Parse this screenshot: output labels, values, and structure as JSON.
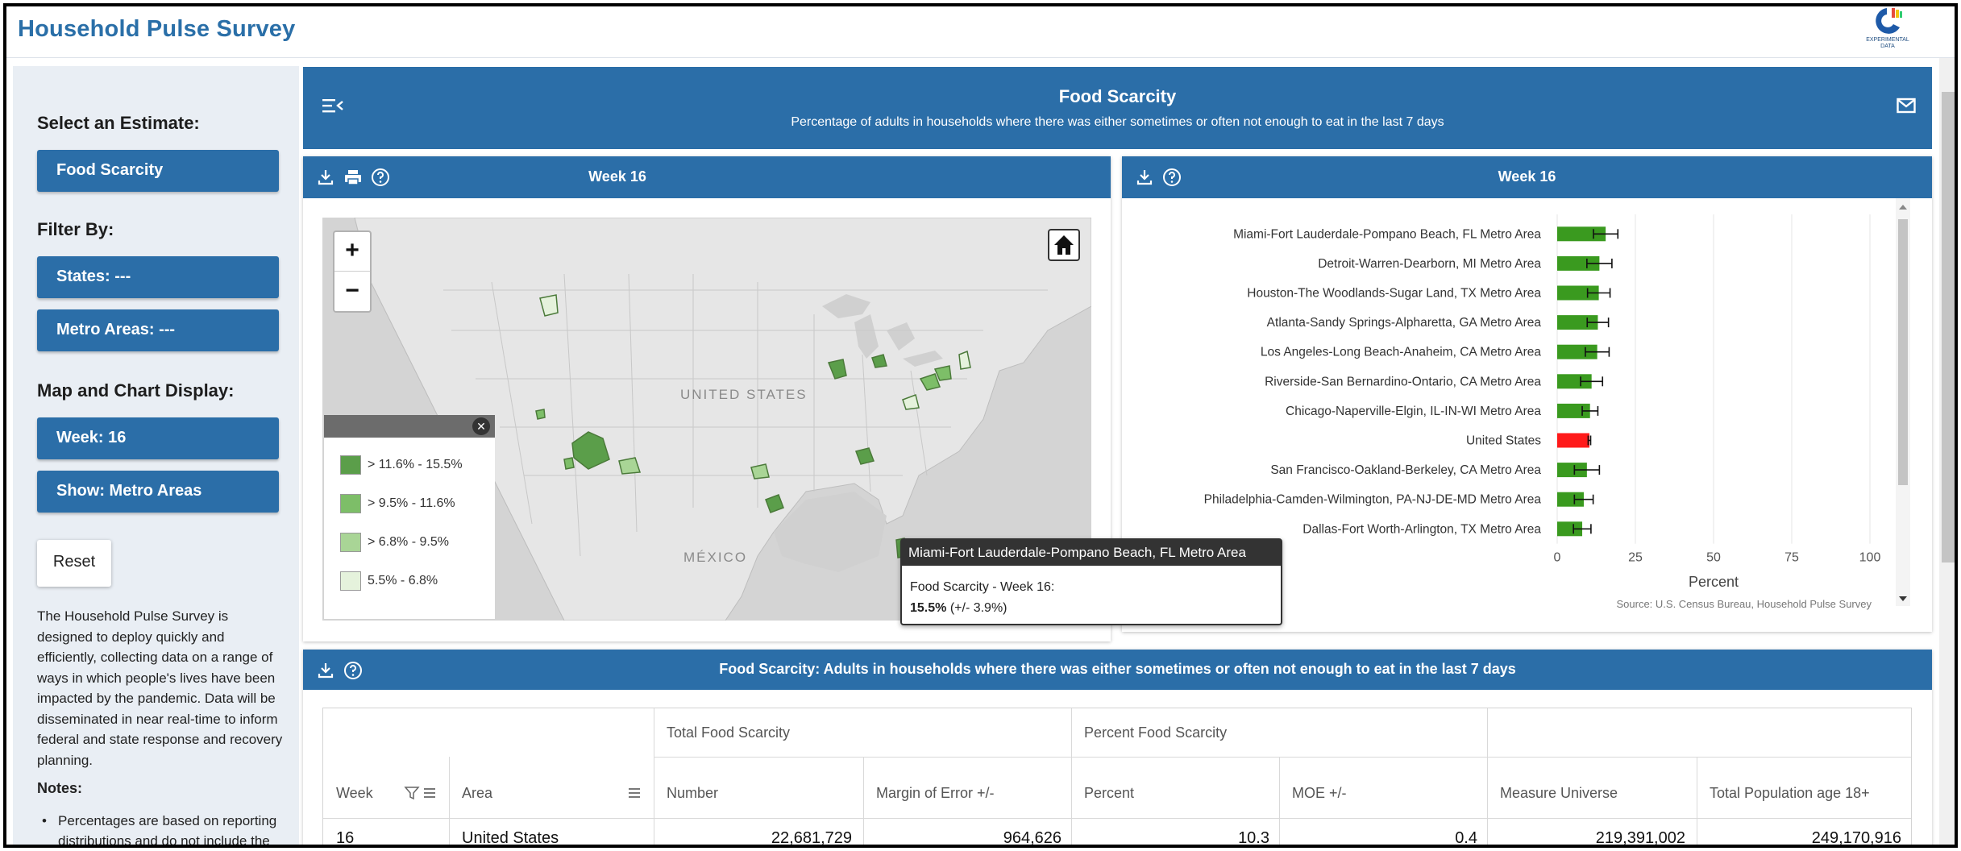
{
  "app": {
    "title": "Household Pulse Survey",
    "logo_text": "EXPERIMENTAL DATA"
  },
  "sidebar": {
    "select_heading": "Select an Estimate:",
    "estimate_button": "Food Scarcity",
    "filter_heading": "Filter By:",
    "states_button": "States: ---",
    "metros_button": "Metro Areas: ---",
    "display_heading": "Map and Chart Display:",
    "week_button": "Week: 16",
    "show_button": "Show: Metro Areas",
    "reset_button": "Reset",
    "about_text": "The Household Pulse Survey is designed to deploy quickly and efficiently, collecting data on a range of ways in which people's lives have been impacted by the pandemic. Data will be disseminated in near real-time to inform federal and state response and recovery planning.",
    "notes_title": "Notes:",
    "note_1": "Percentages are based on reporting distributions and do not include the"
  },
  "banner": {
    "title": "Food Scarcity",
    "subtitle": "Percentage of adults in households where there was either sometimes or often not enough to eat in the last 7 days"
  },
  "map_panel": {
    "title": "Week 16",
    "label_country": "UNITED STATES",
    "label_mexico": "MÉXICO",
    "zoom_in": "+",
    "zoom_out": "−",
    "legend": [
      {
        "label": "> 11.6% - 15.5%",
        "color": "#5b9e4a"
      },
      {
        "label": "> 9.5% - 11.6%",
        "color": "#7dbe68"
      },
      {
        "label": "> 6.8% - 9.5%",
        "color": "#a9d596"
      },
      {
        "label": "5.5% - 6.8%",
        "color": "#e5f2dc"
      }
    ],
    "tooltip": {
      "header": "Miami-Fort Lauderdale-Pompano Beach, FL Metro Area",
      "line1": "Food Scarcity - Week 16:",
      "value": "15.5%",
      "moe": " (+/- 3.9%)"
    }
  },
  "chart_panel": {
    "title": "Week 16",
    "source": "Source: U.S. Census Bureau, Household Pulse Survey"
  },
  "chart_data": {
    "type": "bar",
    "orientation": "horizontal",
    "xlabel": "Percent",
    "xlim": [
      0,
      100
    ],
    "xticks": [
      0,
      25,
      50,
      75,
      100
    ],
    "grid": true,
    "categories": [
      "Miami-Fort Lauderdale-Pompano Beach, FL Metro Area",
      "Detroit-Warren-Dearborn, MI Metro Area",
      "Houston-The Woodlands-Sugar Land, TX Metro Area",
      "Atlanta-Sandy Springs-Alpharetta, GA Metro Area",
      "Los Angeles-Long Beach-Anaheim, CA Metro Area",
      "Riverside-San Bernardino-Ontario, CA Metro Area",
      "Chicago-Naperville-Elgin, IL-IN-WI Metro Area",
      "United States",
      "San Francisco-Oakland-Berkeley, CA Metro Area",
      "Philadelphia-Camden-Wilmington, PA-NJ-DE-MD Metro Area",
      "Dallas-Fort Worth-Arlington, TX Metro Area"
    ],
    "values": [
      15.5,
      13.5,
      13.3,
      13.0,
      12.8,
      11.0,
      10.5,
      10.3,
      9.5,
      8.5,
      8.0
    ],
    "moe": [
      3.9,
      4.0,
      3.6,
      3.4,
      3.8,
      3.5,
      2.5,
      0.4,
      4.0,
      3.0,
      2.8
    ],
    "colors": {
      "default": "#3a9a1f",
      "highlight": "#ff1a1a"
    },
    "highlight": "United States"
  },
  "table_panel": {
    "title": "Food Scarcity: Adults in households where there was either sometimes or often not enough to eat in the last 7 days",
    "group_headers": [
      "Total Food Scarcity",
      "Percent Food Scarcity"
    ],
    "columns": [
      "Week",
      "Area",
      "Number",
      "Margin of Error +/-",
      "Percent",
      "MOE +/-",
      "Measure Universe",
      "Total Population age 18+"
    ],
    "rows": [
      [
        "16",
        "United States",
        "22,681,729",
        "964,626",
        "10.3",
        "0.4",
        "219,391,002",
        "249,170,916"
      ]
    ]
  }
}
